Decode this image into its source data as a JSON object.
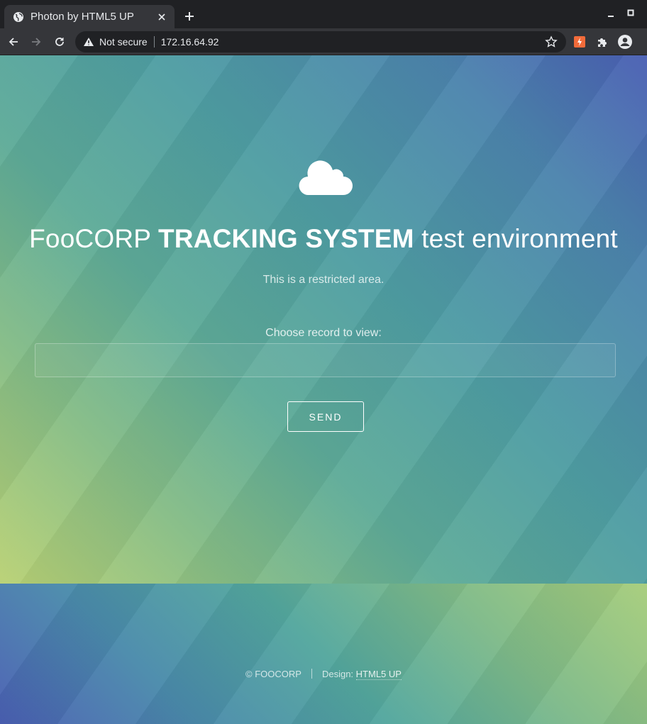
{
  "browser": {
    "tab_title": "Photon by HTML5 UP",
    "security_label": "Not secure",
    "url": "172.16.64.92"
  },
  "hero": {
    "title_prefix": "FooCORP",
    "title_bold": "TRACKING SYSTEM",
    "title_suffix": "test environment",
    "subtitle": "This is a restricted area."
  },
  "form": {
    "label": "Choose record to view:",
    "input_value": "",
    "button_label": "SEND"
  },
  "footer": {
    "copyright": "© FOOCORP",
    "design_label": "Design:",
    "design_link": "HTML5 UP"
  },
  "icons": {
    "tab": "globe-icon",
    "hero": "cloud-icon"
  },
  "colors": {
    "gradient_blue": "#4a5fb3",
    "gradient_teal": "#4f9ea3",
    "gradient_green": "#b9d174"
  }
}
